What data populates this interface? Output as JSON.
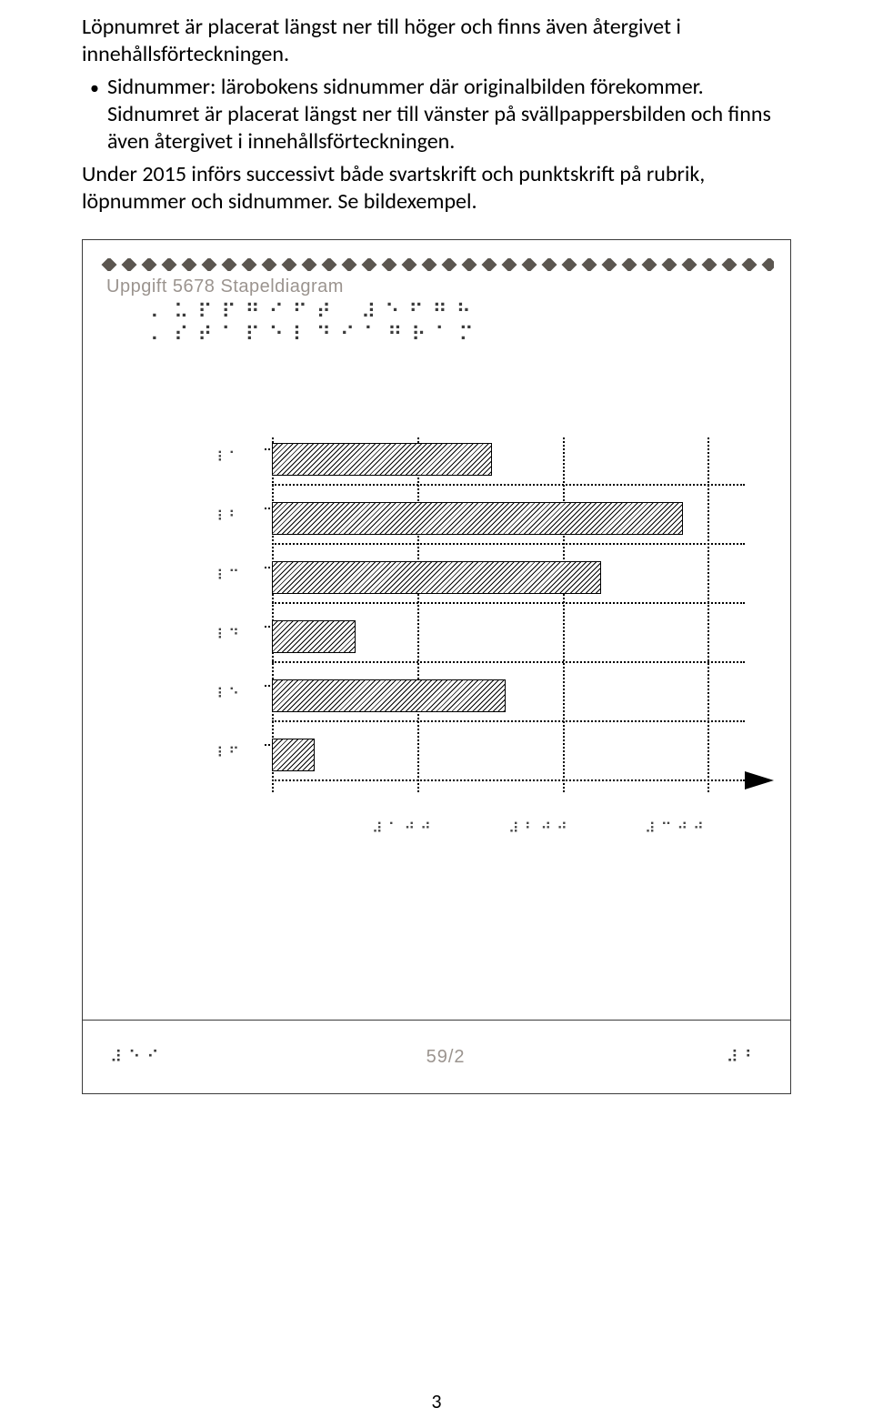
{
  "text": {
    "p1": "Löpnumret är placerat längst ner till höger och finns även återgivet i innehållsförteckningen.",
    "bullet_1a": "Sidnummer: lärobokens sidnummer där originalbilden förekommer. Sidnumret är placerat längst ner till vänster på svällpappersbilden och finns även återgivet i innehållsförteckningen.",
    "p2": "Under 2015 införs successivt både svartskrift och punktskrift på rubrik, löpnummer och sidnummer. Se bildexempel.",
    "bullet_glyph": "•"
  },
  "figure": {
    "print_title": "Uppgift 5678 Stapeldiagram",
    "braille_title": "⠄⠥⠏⠏⠛⠊⠋⠞ ⠼⠑⠋⠛⠓ ⠄⠎⠞⠁⠏⠑⠇⠙⠊⠁⠛⠗⠁⠍",
    "footer_left_braille": "⠼⠑⠊",
    "footer_center_print": "59/2",
    "footer_right_braille": "⠼⠃"
  },
  "chart_data": {
    "type": "bar",
    "orientation": "horizontal",
    "title": "Uppgift 5678 Stapeldiagram",
    "x_ticks_braille": [
      "⠼⠁⠚⠚",
      "⠼⠃⠚⠚",
      "⠼⠉⠚⠚"
    ],
    "x_ticks_values": [
      100,
      200,
      300
    ],
    "xlim": [
      0,
      320
    ],
    "categories_braille": [
      "⠸⠁",
      "⠸⠃",
      "⠸⠉",
      "⠸⠙",
      "⠸⠑",
      "⠸⠋"
    ],
    "values": [
      160,
      300,
      240,
      60,
      170,
      30
    ]
  },
  "page_number": "3"
}
